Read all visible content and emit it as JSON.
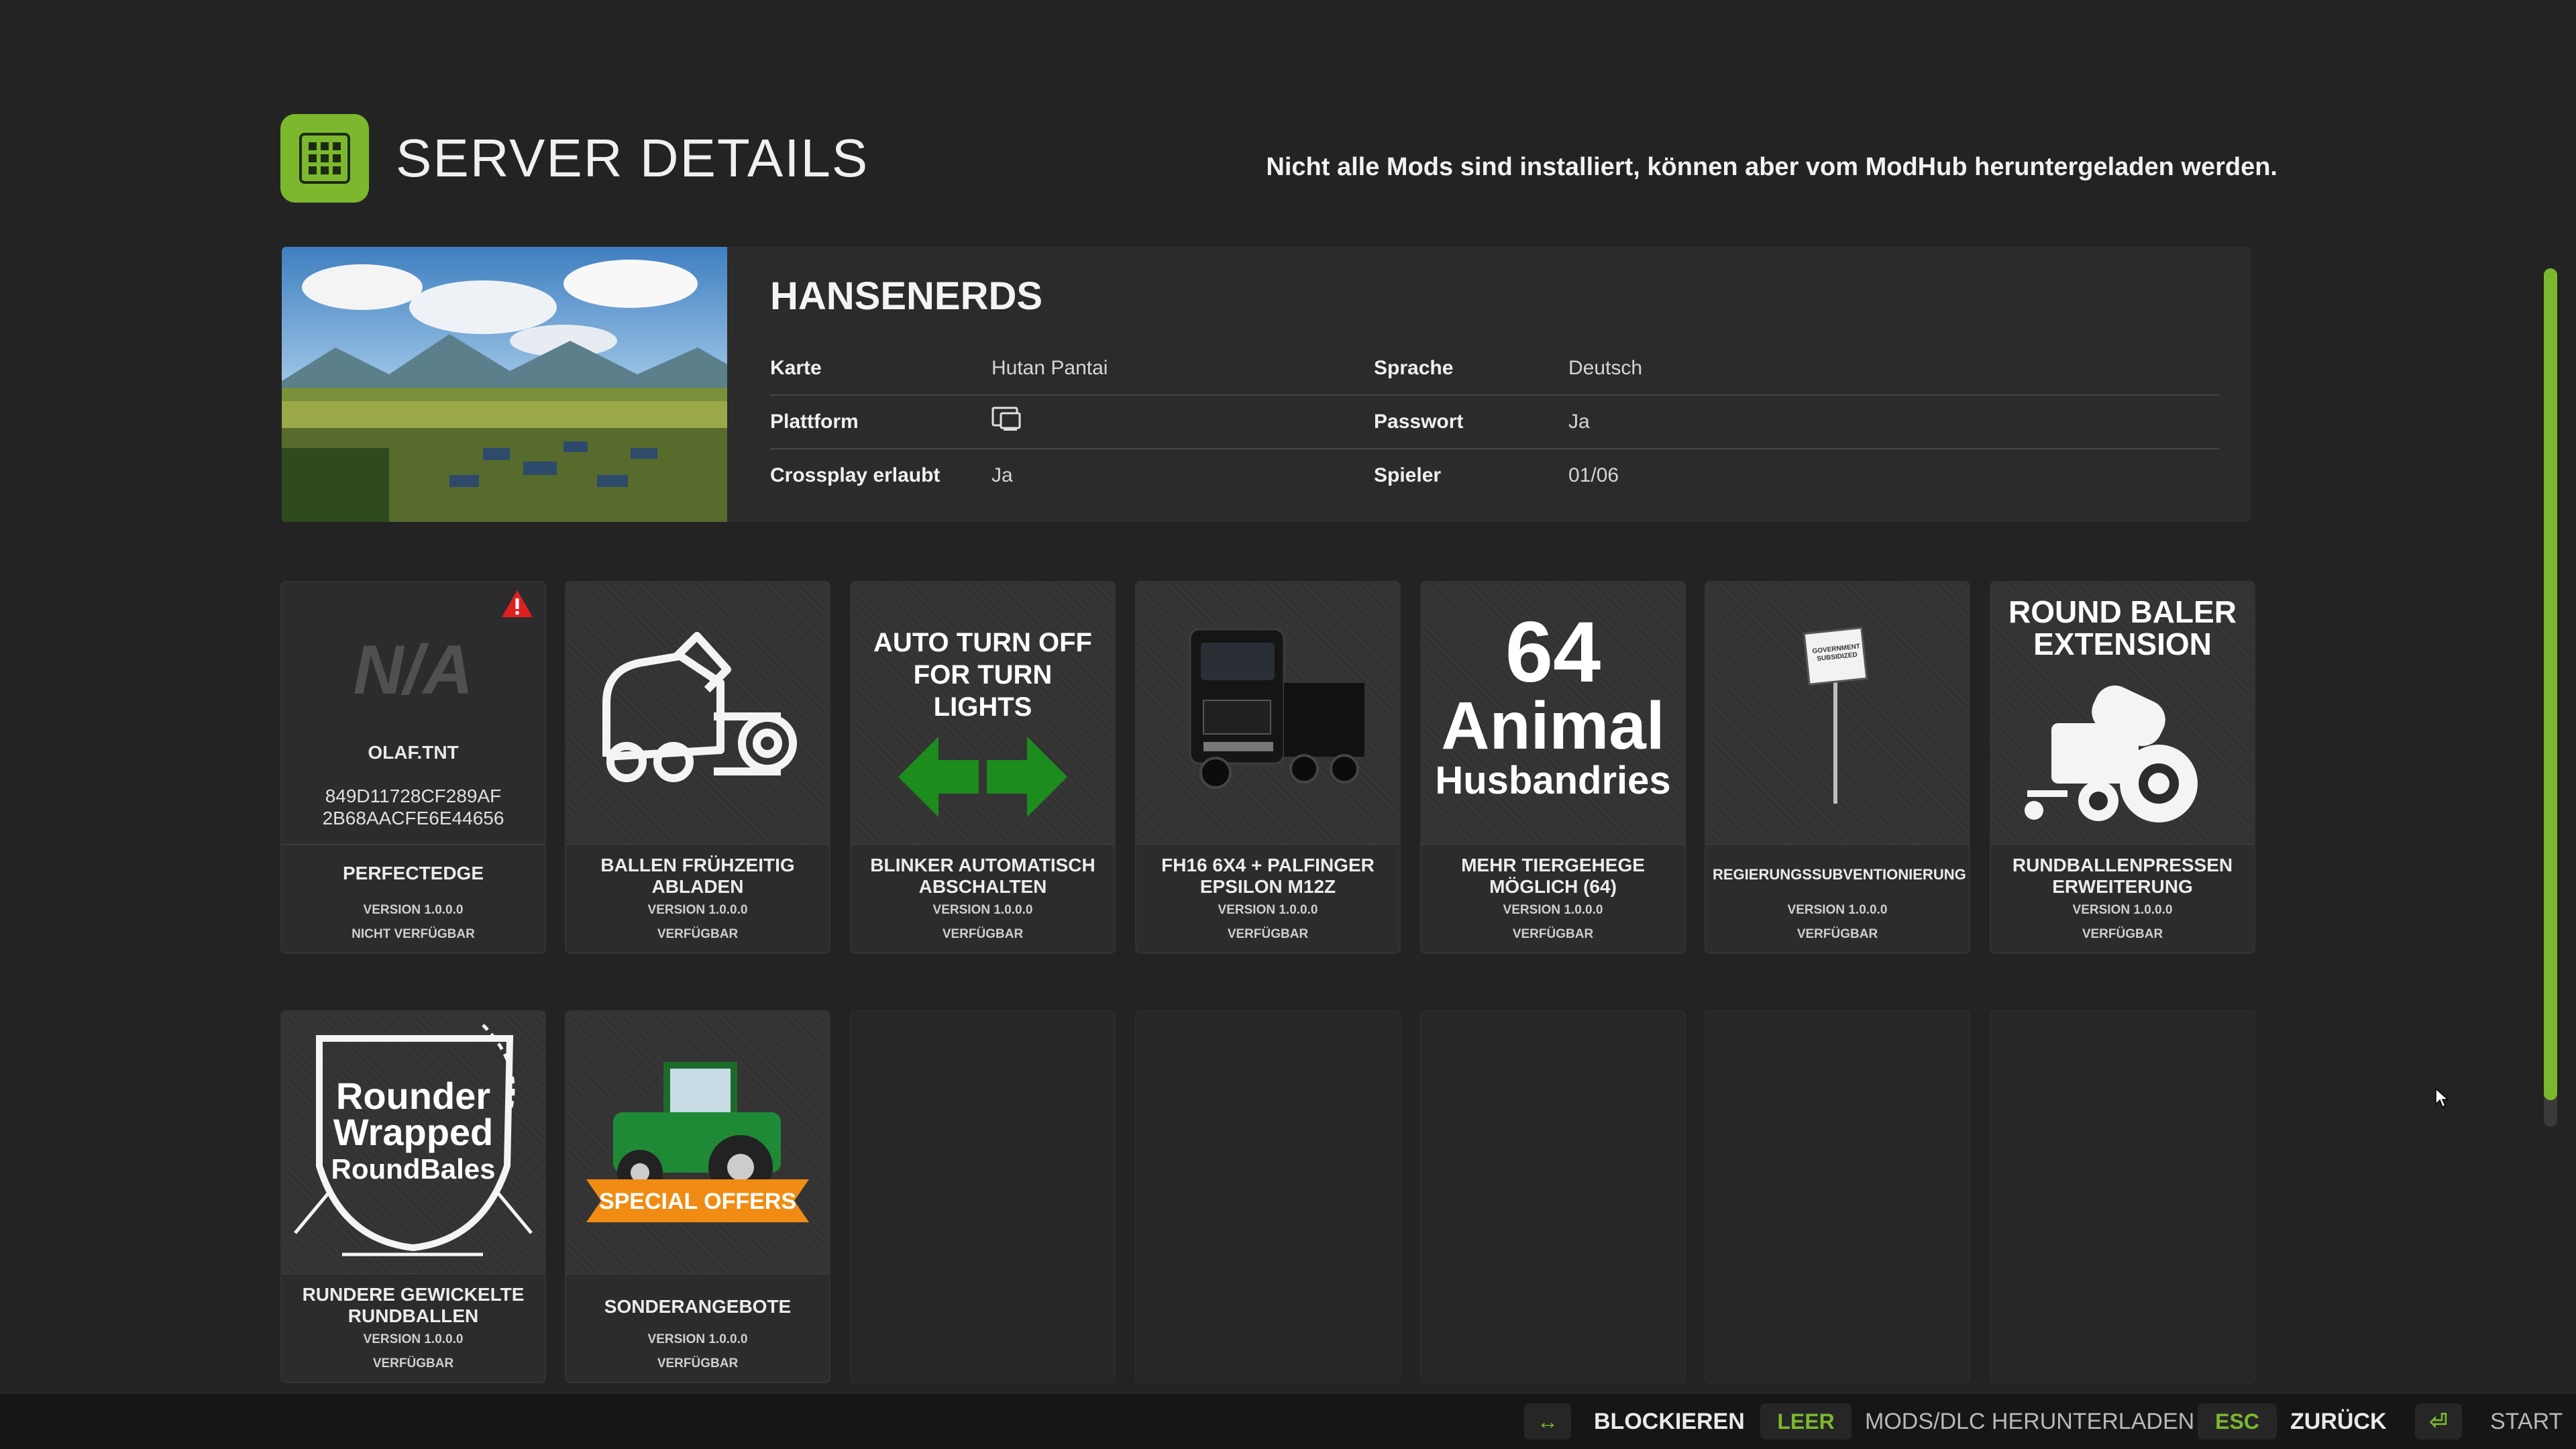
{
  "header": {
    "title": "SERVER DETAILS",
    "notice": "Nicht alle Mods sind installiert, können aber vom ModHub heruntergeladen werden.",
    "icon": "grid-icon"
  },
  "server": {
    "name": "HANSENERDS",
    "rows": [
      {
        "l1": "Karte",
        "v1": "Hutan Pantai",
        "l2": "Sprache",
        "v2": "Deutsch"
      },
      {
        "l1": "Plattform",
        "v1": "",
        "l2": "Passwort",
        "v2": "Ja"
      },
      {
        "l1": "Crossplay erlaubt",
        "v1": "Ja",
        "l2": "Spieler",
        "v2": "01/06"
      }
    ],
    "platform_icon": "pc-monitor-icon"
  },
  "mods": [
    {
      "name": "PERFECTEDGE",
      "version": "VERSION 1.0.0.0",
      "status": "NICHT VERFÜGBAR",
      "na_text": "N/A",
      "author": "OLAF.TNT",
      "hash": "849D11728CF289AF 2B68AACFE6E44656"
    },
    {
      "name": "BALLEN FRÜHZEITIG ABLADEN",
      "version": "VERSION 1.0.0.0",
      "status": "VERFÜGBAR"
    },
    {
      "name": "BLINKER AUTOMATISCH ABSCHALTEN",
      "version": "VERSION 1.0.0.0",
      "status": "VERFÜGBAR",
      "img_text": "AUTO TURN OFF FOR TURN LIGHTS"
    },
    {
      "name": "FH16 6x4 + PALFINGER EPSILON M12Z",
      "version": "VERSION 1.0.0.0",
      "status": "VERFÜGBAR"
    },
    {
      "name": "MEHR TIERGEHEGE MÖGLICH (64)",
      "version": "VERSION 1.0.0.0",
      "status": "VERFÜGBAR",
      "img_big": "64",
      "img_mid": "Animal",
      "img_small": "Husbandries"
    },
    {
      "name": "REGIERUNGSSUBVENTIONIERUNG",
      "version": "VERSION 1.0.0.0",
      "status": "VERFÜGBAR",
      "sign_text": "GOVERNMENT SUBSIDIZED"
    },
    {
      "name": "RUNDBALLENPRESSEN ERWEITERUNG",
      "version": "VERSION 1.0.0.0",
      "status": "VERFÜGBAR",
      "img_text": "ROUND BALER EXTENSION"
    },
    {
      "name": "RUNDERE GEWICKELTE RUNDBALLEN",
      "version": "VERSION 1.0.0.0",
      "status": "VERFÜGBAR",
      "img_l1": "Rounder",
      "img_l2": "Wrapped",
      "img_l3": "RoundBales"
    },
    {
      "name": "SONDERANGEBOTE",
      "version": "VERSION 1.0.0.0",
      "status": "VERFÜGBAR",
      "img_text": "SPECIAL OFFERS"
    }
  ],
  "footer": {
    "block_key": "↔",
    "block_label": "BLOCKIEREN",
    "download_key": "LEER",
    "download_label": "MODS/DLC HERUNTERLADEN",
    "back_key": "ESC",
    "back_label": "ZURÜCK",
    "start_key": "⏎",
    "start_label": "START"
  },
  "colors": {
    "accent": "#7cb82e",
    "warning": "#e02020",
    "arrow_green": "#1c8c1c",
    "offer_orange": "#f08c14"
  }
}
